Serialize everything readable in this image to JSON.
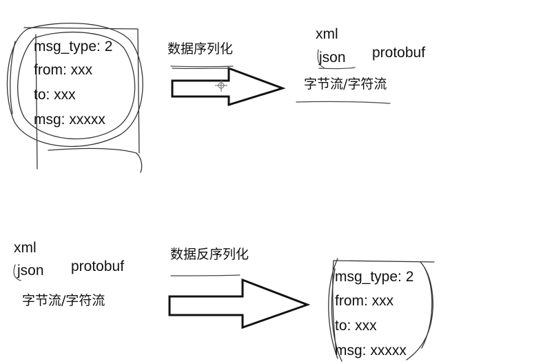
{
  "serialize": {
    "source": {
      "lines": [
        "msg_type: 2",
        "from: xxx",
        "to: xxx",
        "msg: xxxxx"
      ]
    },
    "arrow_label": "数据序列化",
    "formats": {
      "xml": "xml",
      "json": "json",
      "protobuf": "protobuf",
      "stream": "字节流/字符流"
    }
  },
  "deserialize": {
    "formats": {
      "xml": "xml",
      "json": "json",
      "protobuf": "protobuf",
      "stream": "字节流/字符流"
    },
    "arrow_label": "数据反序列化",
    "target": {
      "lines": [
        "msg_type: 2",
        "from: xxx",
        "to: xxx",
        "msg: xxxxx"
      ]
    }
  },
  "colors": {
    "ink": "#111111",
    "pencil": "#555555",
    "sketch": "#333333"
  }
}
